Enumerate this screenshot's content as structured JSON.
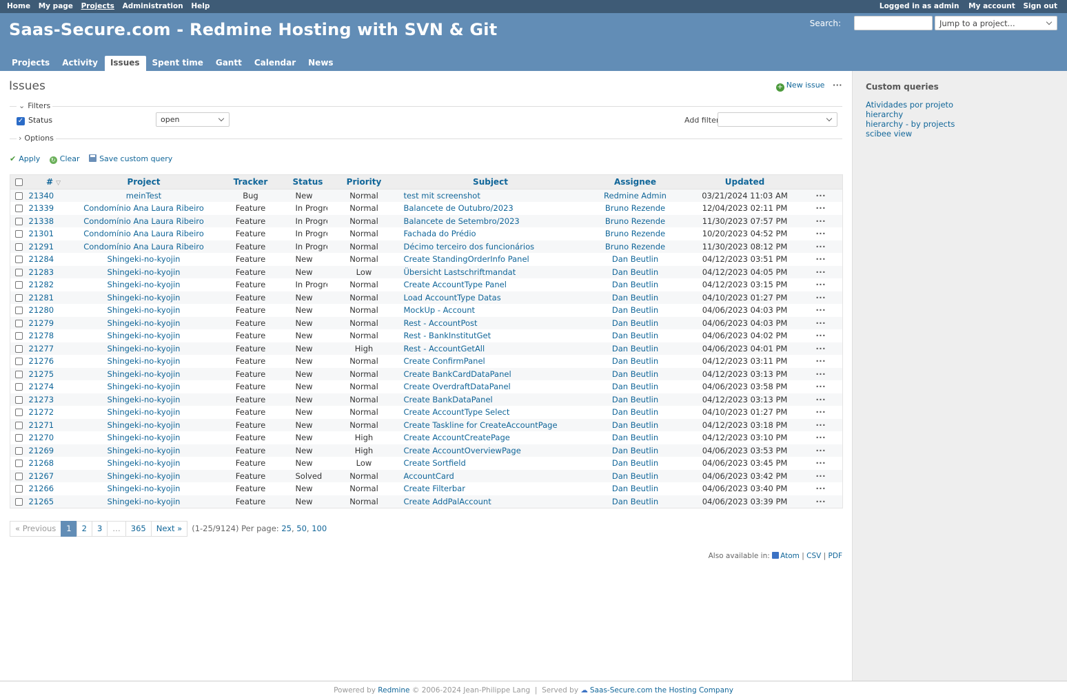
{
  "top_menu": {
    "left": [
      "Home",
      "My page",
      "Projects",
      "Administration",
      "Help"
    ],
    "logged_in_as": "Logged in as admin",
    "my_account": "My account",
    "sign_out": "Sign out"
  },
  "header": {
    "site_title": "Saas-Secure.com - Redmine Hosting with SVN & Git",
    "search_label": "Search:",
    "search_value": "",
    "jump_to_project": "Jump to a project..."
  },
  "main_menu": {
    "tabs": [
      "Projects",
      "Activity",
      "Issues",
      "Spent time",
      "Gantt",
      "Calendar",
      "News"
    ],
    "selected": "Issues"
  },
  "content": {
    "title": "Issues",
    "new_issue": "New issue",
    "filters_legend": "Filters",
    "status_filter_label": "Status",
    "status_filter_value": "open",
    "add_filter_label": "Add filter",
    "options_legend": "Options",
    "apply": "Apply",
    "clear": "Clear",
    "save_custom_query": "Save custom query"
  },
  "table": {
    "headers": {
      "id": "#",
      "project": "Project",
      "tracker": "Tracker",
      "status": "Status",
      "priority": "Priority",
      "subject": "Subject",
      "assignee": "Assignee",
      "updated": "Updated"
    },
    "rows": [
      {
        "id": "21340",
        "project": "meinTest",
        "tracker": "Bug",
        "status": "New",
        "priority": "Normal",
        "subject": "test mit screenshot",
        "assignee": "Redmine Admin",
        "updated": "03/21/2024 11:03 AM"
      },
      {
        "id": "21339",
        "project": "Condomínio Ana Laura Ribeiro",
        "tracker": "Feature",
        "status": "In Progress",
        "priority": "Normal",
        "subject": "Balancete de Outubro/2023",
        "assignee": "Bruno Rezende",
        "updated": "12/04/2023 02:11 PM"
      },
      {
        "id": "21338",
        "project": "Condomínio Ana Laura Ribeiro",
        "tracker": "Feature",
        "status": "In Progress",
        "priority": "Normal",
        "subject": "Balancete de Setembro/2023",
        "assignee": "Bruno Rezende",
        "updated": "11/30/2023 07:57 PM"
      },
      {
        "id": "21301",
        "project": "Condomínio Ana Laura Ribeiro",
        "tracker": "Feature",
        "status": "In Progress",
        "priority": "Normal",
        "subject": "Fachada do Prédio",
        "assignee": "Bruno Rezende",
        "updated": "10/20/2023 04:52 PM"
      },
      {
        "id": "21291",
        "project": "Condomínio Ana Laura Ribeiro",
        "tracker": "Feature",
        "status": "In Progress",
        "priority": "Normal",
        "subject": "Décimo terceiro dos funcionários",
        "assignee": "Bruno Rezende",
        "updated": "11/30/2023 08:12 PM"
      },
      {
        "id": "21284",
        "project": "Shingeki-no-kyojin",
        "tracker": "Feature",
        "status": "New",
        "priority": "Normal",
        "subject": "Create StandingOrderInfo Panel",
        "assignee": "Dan Beutlin",
        "updated": "04/12/2023 03:51 PM"
      },
      {
        "id": "21283",
        "project": "Shingeki-no-kyojin",
        "tracker": "Feature",
        "status": "New",
        "priority": "Low",
        "subject": "Übersicht Lastschriftmandat",
        "assignee": "Dan Beutlin",
        "updated": "04/12/2023 04:05 PM"
      },
      {
        "id": "21282",
        "project": "Shingeki-no-kyojin",
        "tracker": "Feature",
        "status": "In Progress",
        "priority": "Normal",
        "subject": "Create AccountType Panel",
        "assignee": "Dan Beutlin",
        "updated": "04/12/2023 03:15 PM"
      },
      {
        "id": "21281",
        "project": "Shingeki-no-kyojin",
        "tracker": "Feature",
        "status": "New",
        "priority": "Normal",
        "subject": "Load AccountType Datas",
        "assignee": "Dan Beutlin",
        "updated": "04/10/2023 01:27 PM"
      },
      {
        "id": "21280",
        "project": "Shingeki-no-kyojin",
        "tracker": "Feature",
        "status": "New",
        "priority": "Normal",
        "subject": "MockUp - Account",
        "assignee": "Dan Beutlin",
        "updated": "04/06/2023 04:03 PM"
      },
      {
        "id": "21279",
        "project": "Shingeki-no-kyojin",
        "tracker": "Feature",
        "status": "New",
        "priority": "Normal",
        "subject": "Rest - AccountPost",
        "assignee": "Dan Beutlin",
        "updated": "04/06/2023 04:03 PM"
      },
      {
        "id": "21278",
        "project": "Shingeki-no-kyojin",
        "tracker": "Feature",
        "status": "New",
        "priority": "Normal",
        "subject": "Rest - BankInstitutGet",
        "assignee": "Dan Beutlin",
        "updated": "04/06/2023 04:02 PM"
      },
      {
        "id": "21277",
        "project": "Shingeki-no-kyojin",
        "tracker": "Feature",
        "status": "New",
        "priority": "High",
        "subject": "Rest - AccountGetAll",
        "assignee": "Dan Beutlin",
        "updated": "04/06/2023 04:01 PM"
      },
      {
        "id": "21276",
        "project": "Shingeki-no-kyojin",
        "tracker": "Feature",
        "status": "New",
        "priority": "Normal",
        "subject": "Create ConfirmPanel",
        "assignee": "Dan Beutlin",
        "updated": "04/12/2023 03:11 PM"
      },
      {
        "id": "21275",
        "project": "Shingeki-no-kyojin",
        "tracker": "Feature",
        "status": "New",
        "priority": "Normal",
        "subject": "Create BankCardDataPanel",
        "assignee": "Dan Beutlin",
        "updated": "04/12/2023 03:13 PM"
      },
      {
        "id": "21274",
        "project": "Shingeki-no-kyojin",
        "tracker": "Feature",
        "status": "New",
        "priority": "Normal",
        "subject": "Create OverdraftDataPanel",
        "assignee": "Dan Beutlin",
        "updated": "04/06/2023 03:58 PM"
      },
      {
        "id": "21273",
        "project": "Shingeki-no-kyojin",
        "tracker": "Feature",
        "status": "New",
        "priority": "Normal",
        "subject": "Create BankDataPanel",
        "assignee": "Dan Beutlin",
        "updated": "04/12/2023 03:13 PM"
      },
      {
        "id": "21272",
        "project": "Shingeki-no-kyojin",
        "tracker": "Feature",
        "status": "New",
        "priority": "Normal",
        "subject": "Create AccountType Select",
        "assignee": "Dan Beutlin",
        "updated": "04/10/2023 01:27 PM"
      },
      {
        "id": "21271",
        "project": "Shingeki-no-kyojin",
        "tracker": "Feature",
        "status": "New",
        "priority": "Normal",
        "subject": "Create Taskline for CreateAccountPage",
        "assignee": "Dan Beutlin",
        "updated": "04/12/2023 03:18 PM"
      },
      {
        "id": "21270",
        "project": "Shingeki-no-kyojin",
        "tracker": "Feature",
        "status": "New",
        "priority": "High",
        "subject": "Create AccountCreatePage",
        "assignee": "Dan Beutlin",
        "updated": "04/12/2023 03:10 PM"
      },
      {
        "id": "21269",
        "project": "Shingeki-no-kyojin",
        "tracker": "Feature",
        "status": "New",
        "priority": "High",
        "subject": "Create AccountOverviewPage",
        "assignee": "Dan Beutlin",
        "updated": "04/06/2023 03:53 PM"
      },
      {
        "id": "21268",
        "project": "Shingeki-no-kyojin",
        "tracker": "Feature",
        "status": "New",
        "priority": "Low",
        "subject": "Create Sortfield",
        "assignee": "Dan Beutlin",
        "updated": "04/06/2023 03:45 PM"
      },
      {
        "id": "21267",
        "project": "Shingeki-no-kyojin",
        "tracker": "Feature",
        "status": "Solved",
        "priority": "Normal",
        "subject": "AccountCard",
        "assignee": "Dan Beutlin",
        "updated": "04/06/2023 03:42 PM"
      },
      {
        "id": "21266",
        "project": "Shingeki-no-kyojin",
        "tracker": "Feature",
        "status": "New",
        "priority": "Normal",
        "subject": "Create Filterbar",
        "assignee": "Dan Beutlin",
        "updated": "04/06/2023 03:40 PM"
      },
      {
        "id": "21265",
        "project": "Shingeki-no-kyojin",
        "tracker": "Feature",
        "status": "New",
        "priority": "Normal",
        "subject": "Create AddPalAccount",
        "assignee": "Dan Beutlin",
        "updated": "04/06/2023 03:39 PM"
      }
    ]
  },
  "pagination": {
    "previous": "« Previous",
    "pages": [
      "1",
      "2",
      "3",
      "…",
      "365"
    ],
    "current": "1",
    "next": "Next »",
    "info": "(1-25/9124) Per page:",
    "per_page": [
      "25",
      "50",
      "100"
    ]
  },
  "other_formats": {
    "label": "Also available in:",
    "formats": [
      "Atom",
      "CSV",
      "PDF"
    ]
  },
  "sidebar": {
    "title": "Custom queries",
    "queries": [
      "Atividades por projeto",
      "hierarchy",
      "hierarchy - by projects",
      "scibee view"
    ]
  },
  "footer": {
    "powered_by": "Powered by",
    "redmine": "Redmine",
    "copyright": "© 2006-2024 Jean-Philippe Lang",
    "served_by": "Served by",
    "host": "Saas-Secure.com the Hosting Company"
  },
  "colors": {
    "top_menu": "#3e5b76",
    "header": "#628db6",
    "link": "#116699",
    "sidebar": "#eeeeee"
  }
}
